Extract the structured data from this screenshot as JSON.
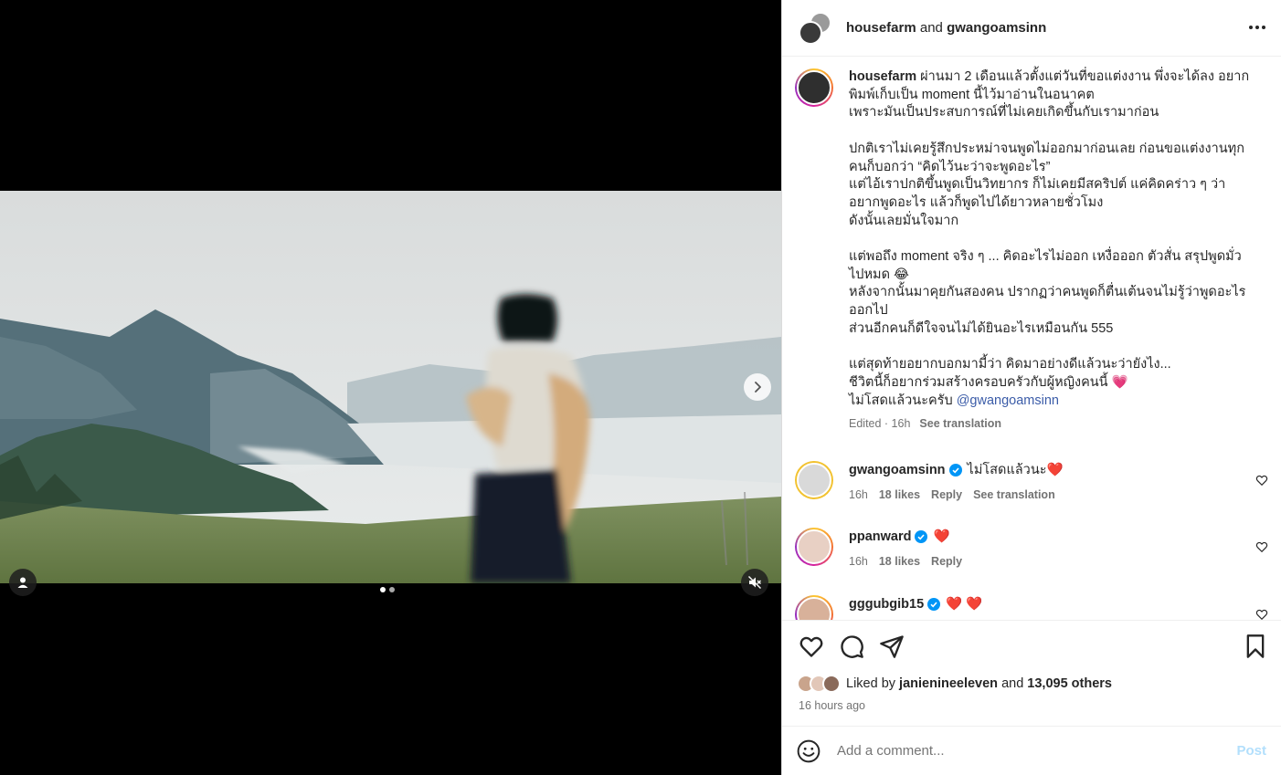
{
  "post": {
    "header": {
      "user1": "housefarm",
      "joiner": " and ",
      "user2": "gwangoamsinn"
    },
    "media": {
      "slide_count": 2,
      "active_slide": 1
    },
    "caption": {
      "username": "housefarm",
      "lines": [
        "ผ่านมา 2 เดือนแล้วตั้งแต่วันที่ขอแต่งงาน พึ่งจะได้ลง อยาก",
        "พิมพ์เก็บเป็น moment นี้ไว้มาอ่านในอนาคต",
        "เพราะมันเป็นประสบการณ์ที่ไม่เคยเกิดขึ้นกับเรามาก่อน",
        "ปกติเราไม่เคยรู้สึกประหม่าจนพูดไม่ออกมาก่อนเลย ก่อนขอแต่งงานทุก",
        "คนก็บอกว่า “คิดไว้นะว่าจะพูดอะไร”",
        "แต่ไอ้เราปกติขึ้นพูดเป็นวิทยากร ก็ไม่เคยมีสคริปต์ แค่คิดคร่าว ๆ ว่า",
        "อยากพูดอะไร แล้วก็พูดไปได้ยาวหลายชั่วโมง",
        "ดังนั้นเลยมั่นใจมาก",
        "แต่พอถึง moment จริง ๆ ... คิดอะไรไม่ออก เหงื่อออก ตัวสั่น สรุปพูดมั่ว",
        "ไปหมด 😂",
        "หลังจากนั้นมาคุยกันสองคน ปรากฏว่าคนพูดก็ตื่นเต้นจนไม่รู้ว่าพูดอะไร",
        "ออกไป",
        "ส่วนอีกคนก็ดีใจจนไม่ได้ยินอะไรเหมือนกัน 555",
        "แต่สุดท้ายอยากบอกมามี้ว่า คิดมาอย่างดีแล้วนะว่ายังไง...",
        "ชีวิตนี้ก็อยากร่วมสร้างครอบครัวกับผู้หญิงคนนี้ 💗",
        "ไม่โสดแล้วนะครับ"
      ],
      "mention": "@gwangoamsinn",
      "edited": "Edited · 16h",
      "see_translation": "See translation"
    },
    "comments": [
      {
        "username": "gwangoamsinn",
        "text": "ไม่โสดแล้วนะ❤️",
        "time": "16h",
        "likes": "18 likes",
        "reply": "Reply",
        "see_translation": "See translation",
        "avatar_color": "#d9d9d9"
      },
      {
        "username": "ppanward",
        "text": "❤️",
        "time": "16h",
        "likes": "18 likes",
        "reply": "Reply",
        "avatar_color": "#e8d0c4"
      },
      {
        "username": "gggubgib15",
        "text": "❤️ ❤️",
        "avatar_color": "#d8b19a"
      }
    ],
    "likes": {
      "prefix": "Liked by ",
      "first_user": "janienineeleven",
      "middle": " and ",
      "count": "13,095 others"
    },
    "time_ago": "16 hours ago",
    "comment_box": {
      "placeholder": "Add a comment...",
      "post_label": "Post"
    }
  },
  "colors": {
    "accent_link": "#3b5ca8",
    "verified": "#0095f6",
    "heart": "#ff3040",
    "post_disabled": "#b2dffc"
  },
  "icons": [
    "next-icon",
    "user-tag-icon",
    "muted-icon",
    "more-icon",
    "verified-icon",
    "heart-outline-icon",
    "comment-icon",
    "share-icon",
    "bookmark-icon",
    "emoji-icon"
  ]
}
